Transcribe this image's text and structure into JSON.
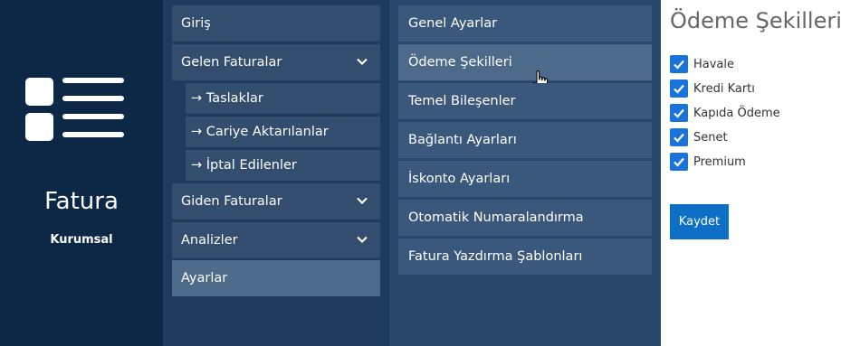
{
  "brand": {
    "title": "Fatura",
    "subtitle": "Kurumsal",
    "logo_icon": "invoice-list-icon"
  },
  "nav": {
    "items": [
      {
        "label": "Giriş"
      },
      {
        "label": "Gelen Faturalar",
        "icon": "chevron-down-icon"
      },
      {
        "label": "→ Taslaklar"
      },
      {
        "label": "→ Cariye Aktarılanlar"
      },
      {
        "label": "→ İptal Edilenler"
      },
      {
        "label": "Giden Faturalar",
        "icon": "chevron-down-icon"
      },
      {
        "label": "Analizler",
        "icon": "chevron-down-icon"
      },
      {
        "label": "Ayarlar",
        "active": true
      }
    ]
  },
  "settings": {
    "items": [
      {
        "label": "Genel Ayarlar"
      },
      {
        "label": "Ödeme Şekilleri",
        "active": true
      },
      {
        "label": "Temel Bileşenler"
      },
      {
        "label": "Bağlantı Ayarları"
      },
      {
        "label": "İskonto Ayarları"
      },
      {
        "label": "Otomatik Numaralandırma"
      },
      {
        "label": "Fatura Yazdırma Şablonları"
      }
    ]
  },
  "content": {
    "title": "Ödeme Şekilleri",
    "options": [
      {
        "label": "Havale",
        "checked": true
      },
      {
        "label": "Kredi Kartı",
        "checked": true
      },
      {
        "label": "Kapıda Ödeme",
        "checked": true
      },
      {
        "label": "Senet",
        "checked": true
      },
      {
        "label": "Premium",
        "checked": true
      }
    ],
    "save_label": "Kaydet"
  },
  "colors": {
    "brand_bg": "#0d2847",
    "nav_bg": "#1f3a5b",
    "settings_bg": "#294869",
    "accent": "#1a73d9"
  }
}
